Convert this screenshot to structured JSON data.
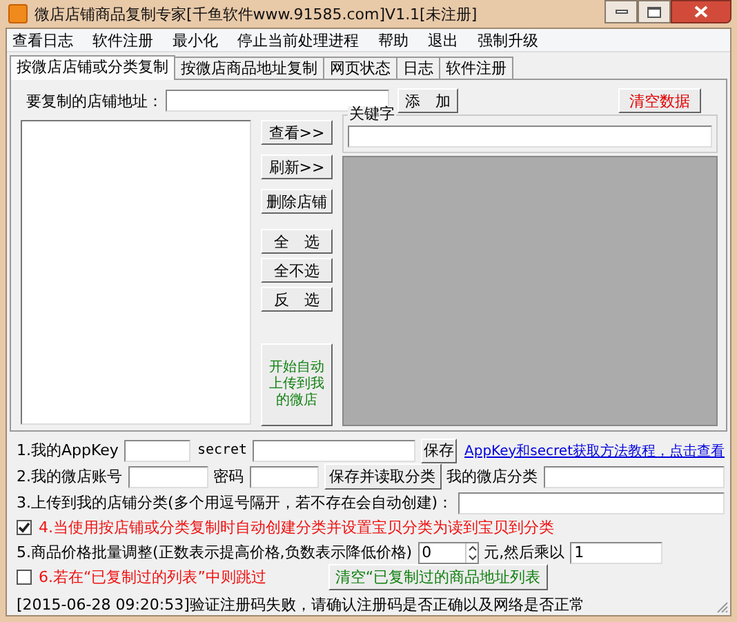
{
  "window": {
    "title": "微店店铺商品复制专家[千鱼软件www.91585.com]V1.1[未注册]"
  },
  "menu": [
    "查看日志",
    "软件注册",
    "最小化",
    "停止当前处理进程",
    "帮助",
    "退出",
    "强制升级"
  ],
  "tabs": [
    {
      "label": "按微店店铺或分类复制",
      "selected": true
    },
    {
      "label": "按微店商品地址复制",
      "selected": false
    },
    {
      "label": "网页状态",
      "selected": false
    },
    {
      "label": "日志",
      "selected": false
    },
    {
      "label": "软件注册",
      "selected": false
    }
  ],
  "shop_url": {
    "label": "要复制的店铺地址：",
    "add_button": "添　加",
    "clear_button": "清空数据"
  },
  "side_buttons": [
    {
      "label": "查看>>",
      "kind": "normal"
    },
    {
      "label": "刷新>>",
      "kind": "normal"
    },
    {
      "label": "删除店铺",
      "kind": "normal"
    },
    {
      "label": "全　选",
      "kind": "gap"
    },
    {
      "label": "全不选",
      "kind": "normal"
    },
    {
      "label": "反　选",
      "kind": "normal"
    },
    {
      "label": "开始自动上传到我的微店",
      "kind": "start"
    }
  ],
  "keyword": {
    "legend": "关键字"
  },
  "settings": {
    "appkey_label": "1.我的AppKey",
    "secret_label": "secret",
    "save_button": "保存",
    "tutorial_link": "AppKey和secret获取方法教程，点击查看",
    "account_label": "2.我的微店账号",
    "password_label": "密码",
    "save_read_button": "保存并读取分类",
    "category_label": "我的微店分类",
    "upload_category_label": "3.上传到我的店铺分类(多个用逗号隔开，若不存在会自动创建)：",
    "auto_create": {
      "label": "4.当使用按店铺或分类复制时自动创建分类并设置宝贝分类为读到宝贝到分类",
      "checked": true
    },
    "price_label": "5.商品价格批量调整(正数表示提高价格,负数表示降低价格)",
    "price_value": "0",
    "multiply_label": "元,然后乘以",
    "multiply_value": "1",
    "skip_copied": {
      "label": "6.若在“已复制过的列表”中则跳过",
      "checked": false
    },
    "clear_copied_button": "清空“已复制过的商品地址列表"
  },
  "status_bar": "[2015-06-28 09:20:53]验证注册码失败，请确认注册码是否正确以及网络是否正常"
}
